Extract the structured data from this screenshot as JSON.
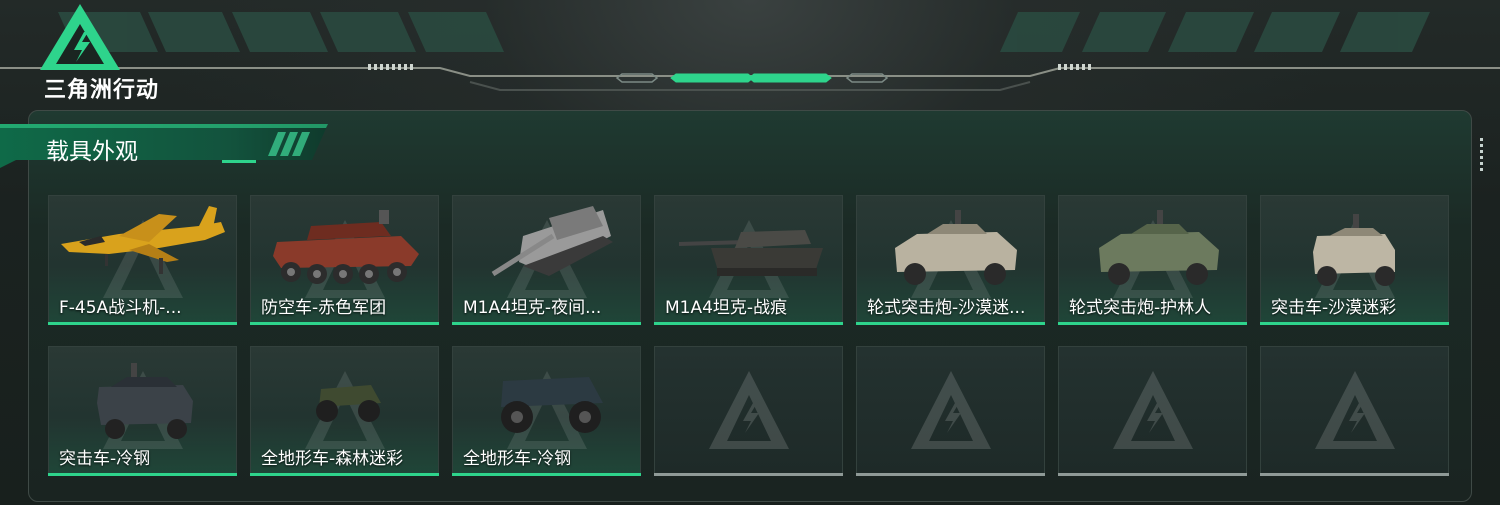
{
  "header": {
    "logo_text": "三角洲行动"
  },
  "section": {
    "title": "载具外观"
  },
  "vehicles": [
    {
      "name": "F-45A战斗机-...",
      "icon": "jet-icon"
    },
    {
      "name": "防空车-赤色军团",
      "icon": "aa-vehicle-icon"
    },
    {
      "name": "M1A4坦克-夜间...",
      "icon": "tank-icon"
    },
    {
      "name": "M1A4坦克-战痕",
      "icon": "tank-icon"
    },
    {
      "name": "轮式突击炮-沙漠迷...",
      "icon": "armored-car-icon"
    },
    {
      "name": "轮式突击炮-护林人",
      "icon": "armored-car-icon"
    },
    {
      "name": "突击车-沙漠迷彩",
      "icon": "assault-car-icon"
    },
    {
      "name": "突击车-冷钢",
      "icon": "assault-car-icon"
    },
    {
      "name": "全地形车-森林迷彩",
      "icon": "atv-icon"
    },
    {
      "name": "全地形车-冷钢",
      "icon": "atv-icon"
    }
  ],
  "empty_slots": 4,
  "colors": {
    "accent": "#2ed48c",
    "empty_bar": "#8f9a97",
    "jet": "#d9a21c",
    "red_camo": "#8a3a2a"
  }
}
